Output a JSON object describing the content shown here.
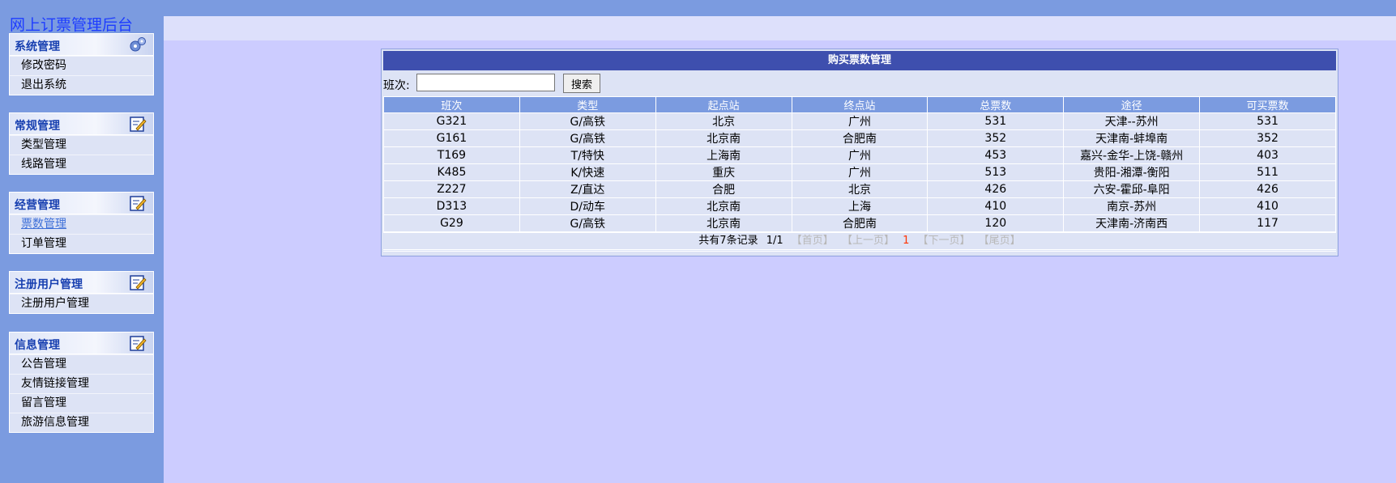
{
  "app": {
    "title": "网上订票管理后台"
  },
  "sidebar": {
    "groups": [
      {
        "title": "系统管理",
        "icon": "settings-gears-icon",
        "items": [
          "修改密码",
          "退出系统"
        ]
      },
      {
        "title": "常规管理",
        "icon": "edit-note-icon",
        "items": [
          "类型管理",
          "线路管理"
        ]
      },
      {
        "title": "经营管理",
        "icon": "edit-note-icon",
        "items": [
          "票数管理",
          "订单管理"
        ],
        "active_item": "票数管理"
      },
      {
        "title": "注册用户管理",
        "icon": "edit-note-icon",
        "items": [
          "注册用户管理"
        ]
      },
      {
        "title": "信息管理",
        "icon": "edit-note-icon",
        "items": [
          "公告管理",
          "友情链接管理",
          "留言管理",
          "旅游信息管理"
        ]
      }
    ]
  },
  "main": {
    "panel_title": "购买票数管理",
    "search": {
      "label": "班次:",
      "value": "",
      "button": "搜索"
    },
    "table": {
      "headers": [
        "班次",
        "类型",
        "起点站",
        "终点站",
        "总票数",
        "途径",
        "可买票数"
      ],
      "rows": [
        [
          "G321",
          "G/高铁",
          "北京",
          "广州",
          "531",
          "天津--苏州",
          "531"
        ],
        [
          "G161",
          "G/高铁",
          "北京南",
          "合肥南",
          "352",
          "天津南-蚌埠南",
          "352"
        ],
        [
          "T169",
          "T/特快",
          "上海南",
          "广州",
          "453",
          "嘉兴-金华-上饶-赣州",
          "403"
        ],
        [
          "K485",
          "K/快速",
          "重庆",
          "广州",
          "513",
          "贵阳-湘潭-衡阳",
          "511"
        ],
        [
          "Z227",
          "Z/直达",
          "合肥",
          "北京",
          "426",
          "六安-霍邱-阜阳",
          "426"
        ],
        [
          "D313",
          "D/动车",
          "北京南",
          "上海",
          "410",
          "南京-苏州",
          "410"
        ],
        [
          "G29",
          "G/高铁",
          "北京南",
          "合肥南",
          "120",
          "天津南-济南西",
          "117"
        ]
      ]
    },
    "pager": {
      "summary": "共有7条记录",
      "page_info": "1/1",
      "first": "【首页】",
      "prev": "【上一页】",
      "current": "1",
      "next": "【下一页】",
      "last": "【尾页】"
    }
  },
  "colors": {
    "sidebar_bg": "#7b9be0",
    "content_bg": "#ccccff",
    "panel_header": "#3e4fae",
    "table_header": "#7b9be0",
    "row_bg": "#dde3f5",
    "app_title": "#1e3dff",
    "group_title": "#173fb0",
    "current_page": "#ff3300"
  }
}
